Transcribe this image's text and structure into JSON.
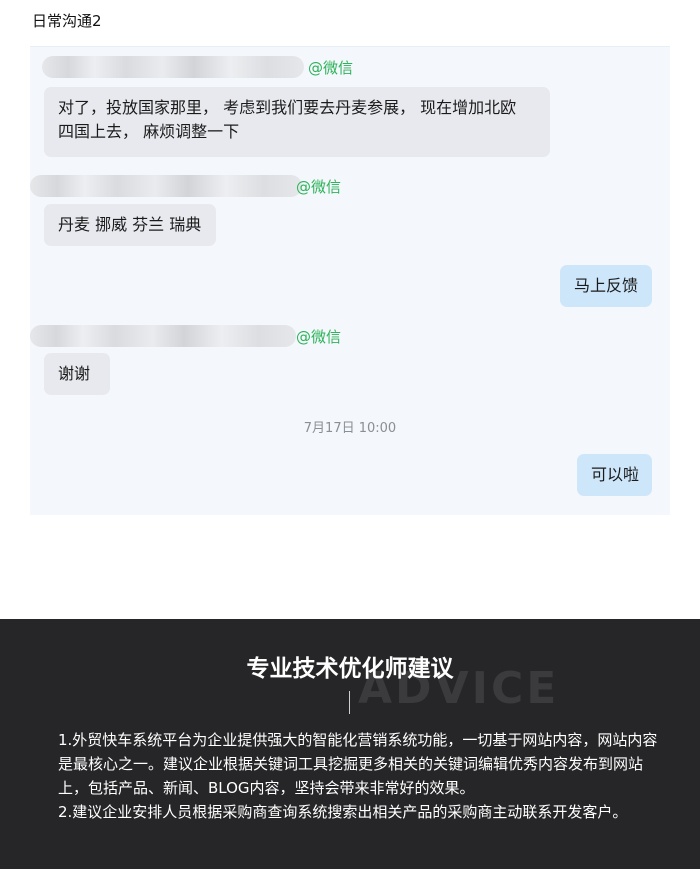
{
  "page": {
    "title": "日常沟通2"
  },
  "chat": {
    "messages": [
      {
        "via": "@微信",
        "text_lines": [
          "对了，投放国家那里， 考虑到我们要去丹麦参展， 现在增加北欧",
          "四国上去， 麻烦调整一下"
        ]
      },
      {
        "via": "@微信",
        "text": "丹麦 挪威 芬兰 瑞典"
      },
      {
        "text": "马上反馈"
      },
      {
        "via": "@微信",
        "text": "谢谢"
      },
      {
        "timestamp": "7月17日 10:00"
      },
      {
        "text": "可以啦"
      }
    ]
  },
  "advice": {
    "bg_word": "ADVICE",
    "title": "专业技术优化师建议",
    "paragraphs": [
      "1.外贸快车系统平台为企业提供强大的智能化营销系统功能，一切基于网站内容，网站内容是最核心之一。建议企业根据关键词工具挖掘更多相关的关键词编辑优秀内容发布到网站上，包括产品、新闻、BLOG内容，坚持会带来非常好的效果。",
      "2.建议企业安排人员根据采购商查询系统搜索出相关产品的采购商主动联系开发客户。"
    ]
  },
  "colors": {
    "wechat_green": "#2db35a",
    "incoming_bubble": "#e7e9ee",
    "outgoing_bubble": "#cde6fa",
    "advice_bg": "#262628"
  }
}
